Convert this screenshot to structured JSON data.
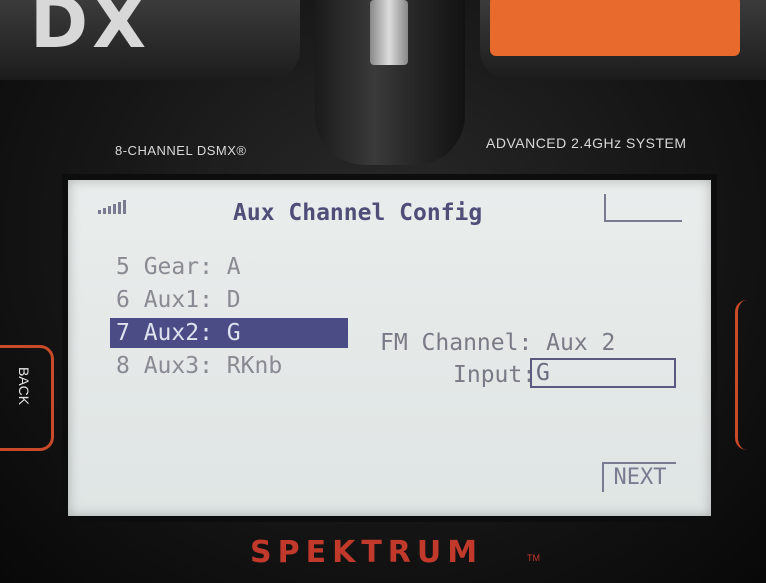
{
  "hardware": {
    "left_label": "8-CHANNEL DSMX®",
    "right_label": "ADVANCED 2.4GHz SYSTEM",
    "back_button": "BACK",
    "brand": "SPEKTRUM",
    "brand_tm": "TM"
  },
  "screen": {
    "title": "Aux Channel Config",
    "signal_icon": "signal-bars-icon",
    "channels": [
      {
        "label": "5 Gear: A",
        "selected": false
      },
      {
        "label": "6 Aux1: D",
        "selected": false
      },
      {
        "label": "7 Aux2: G",
        "selected": true
      },
      {
        "label": "8 Aux3: RKnb",
        "selected": false
      }
    ],
    "fm_channel_label": "FM Channel: Aux 2",
    "input_label": "Input:",
    "input_value": "G",
    "next_label": "NEXT"
  },
  "colors": {
    "selection": "#4b4c86",
    "lcd_background": "#e4e9e8",
    "accent_orange": "#e86a2c",
    "brand_red": "#c0392b"
  }
}
